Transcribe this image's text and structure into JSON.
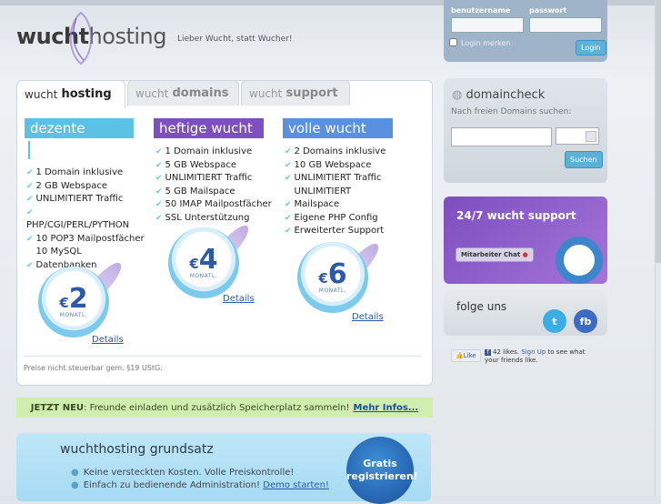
{
  "logo": {
    "wucht": "wucht",
    "hosting": "hosting",
    "slogan": "Lieber Wucht, statt Wucher!"
  },
  "login": {
    "username_label": "benutzername",
    "password_label": "passwort",
    "remember_label": "Login merken",
    "button": "Login"
  },
  "tabs": [
    {
      "small": "wucht",
      "big": "hosting"
    },
    {
      "small": "wucht",
      "big": "domains"
    },
    {
      "small": "wucht",
      "big": "support"
    }
  ],
  "plans": [
    {
      "title": "dezente wucht",
      "features": [
        "1 Domain inklusive",
        "2 GB Webspace",
        "UNLIMITIERT Traffic",
        "PHP/CGI/PERL/PYTHON",
        "10 POP3 Mailpostfächer",
        "10 MySQL Datenbanken"
      ],
      "currency": "€",
      "price": "2",
      "period": "MONATL.",
      "details": "Details"
    },
    {
      "title": "heftige wucht",
      "features": [
        "1 Domain inklusive",
        "5 GB Webspace",
        "UNLIMITIERT Traffic",
        "5 GB Mailspace",
        "50 IMAP Mailpostfächer",
        "SSL Unterstützung"
      ],
      "currency": "€",
      "price": "4",
      "period": "MONATL.",
      "details": "Details"
    },
    {
      "title": "volle wucht",
      "features": [
        "2 Domains inklusive",
        "10 GB Webspace",
        "UNLIMITIERT Traffic",
        "UNLIMITIERT Mailspace",
        "Eigene PHP Config",
        "Erweiterter Support"
      ],
      "currency": "€",
      "price": "6",
      "period": "MONATL.",
      "details": "Details"
    }
  ],
  "note": "Preise nicht steuerbar gem. §19 UStG.",
  "banner": {
    "prefix": "JETZT NEU",
    "text": ": Freunde einladen und zusätzlich Speicherplatz sammeln! ",
    "link": "Mehr Infos..."
  },
  "grundsatz": {
    "title": "wuchthosting grundsatz",
    "items": [
      "Keine versteckten Kosten. Volle Preiskontrolle!",
      "Einfach zu bedienende Administration! "
    ],
    "demo_link": "Demo starten!",
    "gratis_1": "Gratis",
    "gratis_2": "registrieren!"
  },
  "domaincheck": {
    "title": "domaincheck",
    "subtitle": "Nach freien Domains suchen:",
    "button": "Suchen"
  },
  "support": {
    "title": "24/7 wucht support",
    "chat": "Mitarbeiter Chat"
  },
  "folge": {
    "title": "folge uns",
    "twitter": "t",
    "facebook": "fb"
  },
  "facebook": {
    "like": "Like",
    "count_text": "42 likes.",
    "signup": "Sign Up",
    "rest": "to see what your friends like."
  },
  "colors": {
    "plan1": "#5bc1e5",
    "plan2": "#7d4fbf",
    "plan3": "#5b8fe0",
    "login_btn": "#5ab2d8",
    "banner_bg": "#cfeeb0"
  }
}
